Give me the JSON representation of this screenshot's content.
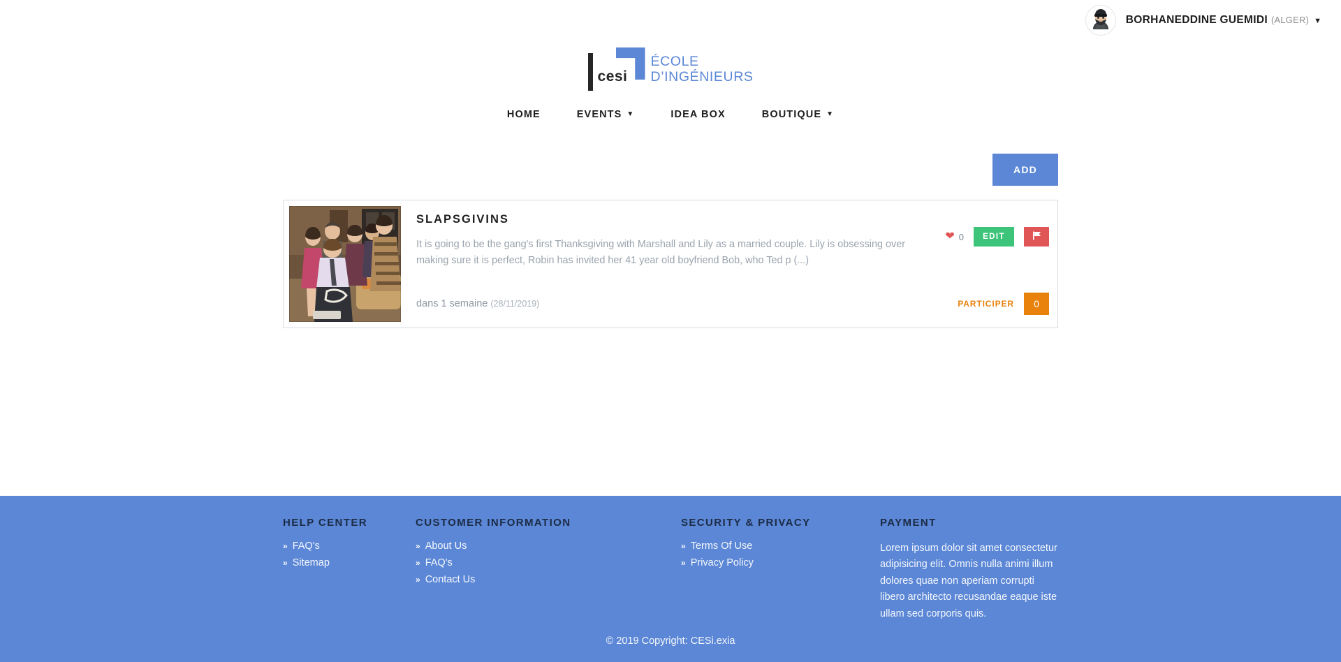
{
  "user": {
    "name": "BORHANEDDINE GUEMIDI",
    "city": "(ALGER)",
    "caret": "▼",
    "avatar_icon": "user-avatar-beanie-beard"
  },
  "logo": {
    "mark_text": "cesi",
    "line1": "ÉCOLE",
    "line2": "D’INGÉNIEURS",
    "brand_color": "#5b87d6"
  },
  "nav": {
    "items": [
      {
        "label": "HOME",
        "has_caret": false,
        "caret": ""
      },
      {
        "label": "EVENTS",
        "has_caret": true,
        "caret": "▼"
      },
      {
        "label": "IDEA BOX",
        "has_caret": false,
        "caret": ""
      },
      {
        "label": "BOUTIQUE",
        "has_caret": true,
        "caret": "▼"
      }
    ]
  },
  "toolbar": {
    "add_label": "ADD",
    "add_color": "#5b87d6"
  },
  "event_card": {
    "title": "SLAPSGIVINS",
    "description": "It is going to be the gang's first Thanksgiving with Marshall and Lily as a married couple. Lily is obsessing over making sure it is perfect, Robin has invited her 41 year old boyfriend Bob, who Ted p (...)",
    "thumbnail_icon": "event-photo-sitcom-scene",
    "like_icon": "heart-icon",
    "like_count": "0",
    "like_color": "#e05656",
    "edit_label": "EDIT",
    "edit_color": "#3bc47a",
    "flag_icon": "flag-icon",
    "flag_color": "#e05656",
    "date_relative": "dans 1 semaine",
    "date_absolute": "(28/11/2019)",
    "participate_label": "PARTICIPER",
    "participate_count": "0",
    "participate_color": "#e8820c"
  },
  "footer": {
    "background": "#5b87d6",
    "chevron_icon": "»",
    "columns": [
      {
        "title": "HELP CENTER",
        "links": [
          "FAQ's",
          "Sitemap"
        ]
      },
      {
        "title": "CUSTOMER INFORMATION",
        "links": [
          "About Us",
          "FAQ's",
          "Contact Us"
        ]
      },
      {
        "title": "SECURITY & PRIVACY",
        "links": [
          "Terms Of Use",
          "Privacy Policy"
        ]
      }
    ],
    "payment": {
      "title": "PAYMENT",
      "text": "Lorem ipsum dolor sit amet consectetur adipisicing elit. Omnis nulla animi illum dolores quae non aperiam corrupti libero architecto recusandae eaque iste ullam sed corporis quis."
    },
    "copyright": "© 2019 Copyright: CESi.exia"
  }
}
